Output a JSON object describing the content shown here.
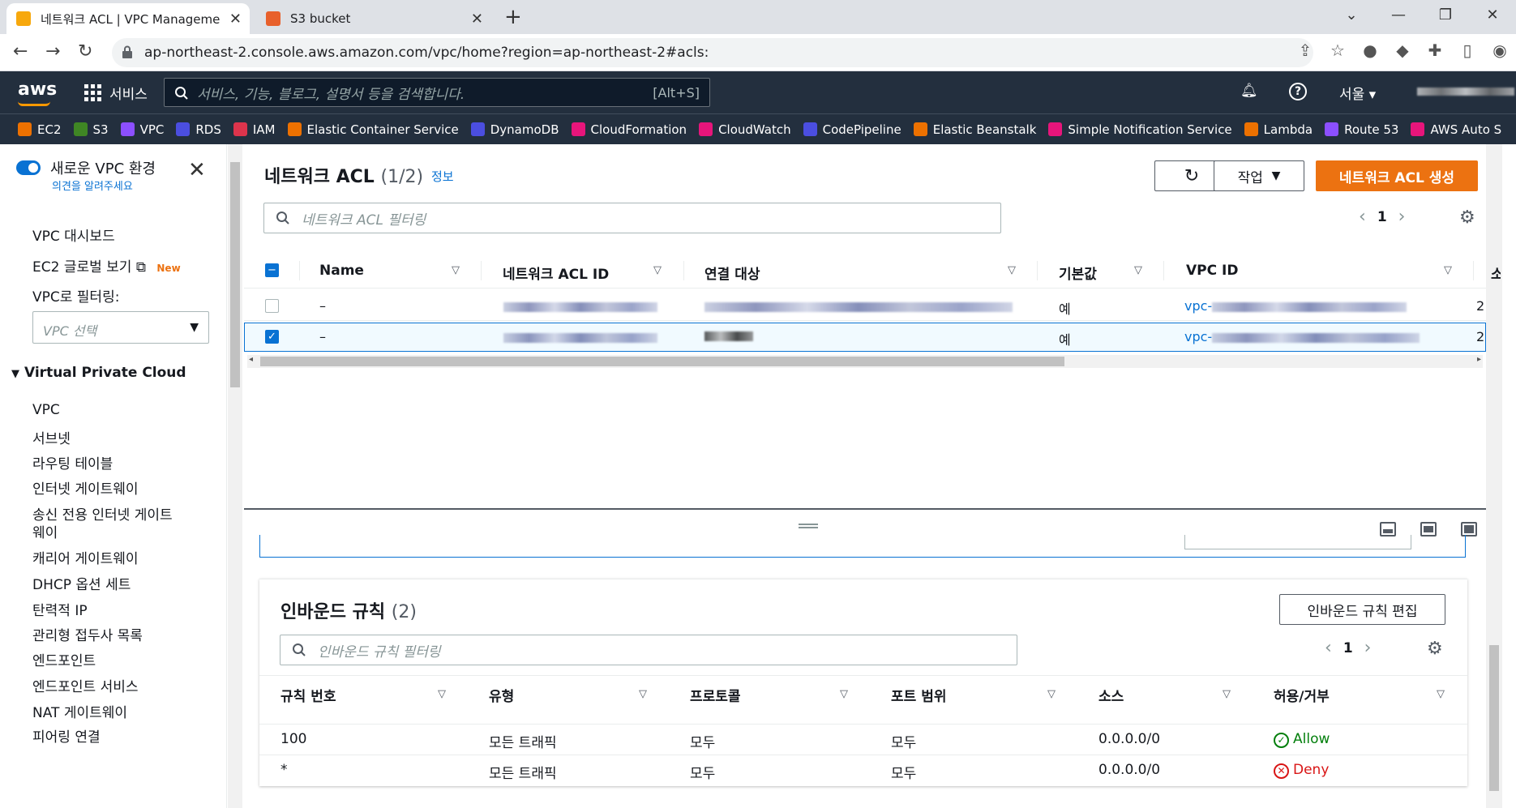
{
  "browser": {
    "tabs": [
      {
        "label": "네트워크 ACL | VPC Manageme",
        "active": true
      },
      {
        "label": "S3 bucket",
        "active": false
      }
    ],
    "url": "ap-northeast-2.console.aws.amazon.com/vpc/home?region=ap-northeast-2#acls:"
  },
  "aws_nav": {
    "logo": "aws",
    "services_label": "서비스",
    "search_placeholder": "서비스, 기능, 블로그, 설명서 등을 검색합니다.",
    "search_shortcut": "[Alt+S]",
    "region": "서울"
  },
  "favorites": [
    {
      "label": "EC2",
      "color": "#ed7100"
    },
    {
      "label": "S3",
      "color": "#3f8624"
    },
    {
      "label": "VPC",
      "color": "#8c4fff"
    },
    {
      "label": "RDS",
      "color": "#4b4ee0"
    },
    {
      "label": "IAM",
      "color": "#dd344c"
    },
    {
      "label": "Elastic Container Service",
      "color": "#ed7100"
    },
    {
      "label": "DynamoDB",
      "color": "#4b4ee0"
    },
    {
      "label": "CloudFormation",
      "color": "#e7157b"
    },
    {
      "label": "CloudWatch",
      "color": "#e7157b"
    },
    {
      "label": "CodePipeline",
      "color": "#4b4ee0"
    },
    {
      "label": "Elastic Beanstalk",
      "color": "#ed7100"
    },
    {
      "label": "Simple Notification Service",
      "color": "#e7157b"
    },
    {
      "label": "Lambda",
      "color": "#ed7100"
    },
    {
      "label": "Route 53",
      "color": "#8c4fff"
    },
    {
      "label": "AWS Auto S",
      "color": "#e7157b"
    }
  ],
  "sidebar": {
    "toggle_title": "새로운 VPC 환경",
    "toggle_sub": "의견을 알려주세요",
    "dashboard": "VPC 대시보드",
    "ec2_global": "EC2 글로벌 보기",
    "new_badge": "New",
    "filter_label": "VPC로 필터링:",
    "vpc_select_placeholder": "VPC 선택",
    "section": "Virtual Private Cloud",
    "items": [
      "VPC",
      "서브넷",
      "라우팅 테이블",
      "인터넷 게이트웨이",
      "송신 전용 인터넷 게이트",
      "웨이",
      "캐리어 게이트웨이",
      "DHCP 옵션 세트",
      "탄력적 IP",
      "관리형 접두사 목록",
      "엔드포인트",
      "엔드포인트 서비스",
      "NAT 게이트웨이",
      "피어링 연결"
    ]
  },
  "main": {
    "title": "네트워크 ACL",
    "count": "(1/2)",
    "info": "정보",
    "actions_label": "작업",
    "create_label": "네트워크 ACL 생성",
    "filter_placeholder": "네트워크 ACL 필터링",
    "page": "1",
    "columns": [
      "Name",
      "네트워크 ACL ID",
      "연결 대상",
      "기본값",
      "VPC ID",
      "소"
    ],
    "rows": [
      {
        "name": "–",
        "default": "예",
        "vpc_prefix": "vpc-",
        "owner": "2",
        "checked": false
      },
      {
        "name": "–",
        "default": "예",
        "vpc_prefix": "vpc-",
        "owner": "2",
        "checked": true
      }
    ]
  },
  "inbound": {
    "title": "인바운드 규칙",
    "count": "(2)",
    "edit_label": "인바운드 규칙 편집",
    "filter_placeholder": "인바운드 규칙 필터링",
    "page": "1",
    "columns": [
      "규칙 번호",
      "유형",
      "프로토콜",
      "포트 범위",
      "소스",
      "허용/거부"
    ],
    "rows": [
      {
        "rule": "100",
        "type": "모든 트래픽",
        "protocol": "모두",
        "port": "모두",
        "source": "0.0.0.0/0",
        "action": "Allow"
      },
      {
        "rule": "*",
        "type": "모든 트래픽",
        "protocol": "모두",
        "port": "모두",
        "source": "0.0.0.0/0",
        "action": "Deny"
      }
    ]
  }
}
